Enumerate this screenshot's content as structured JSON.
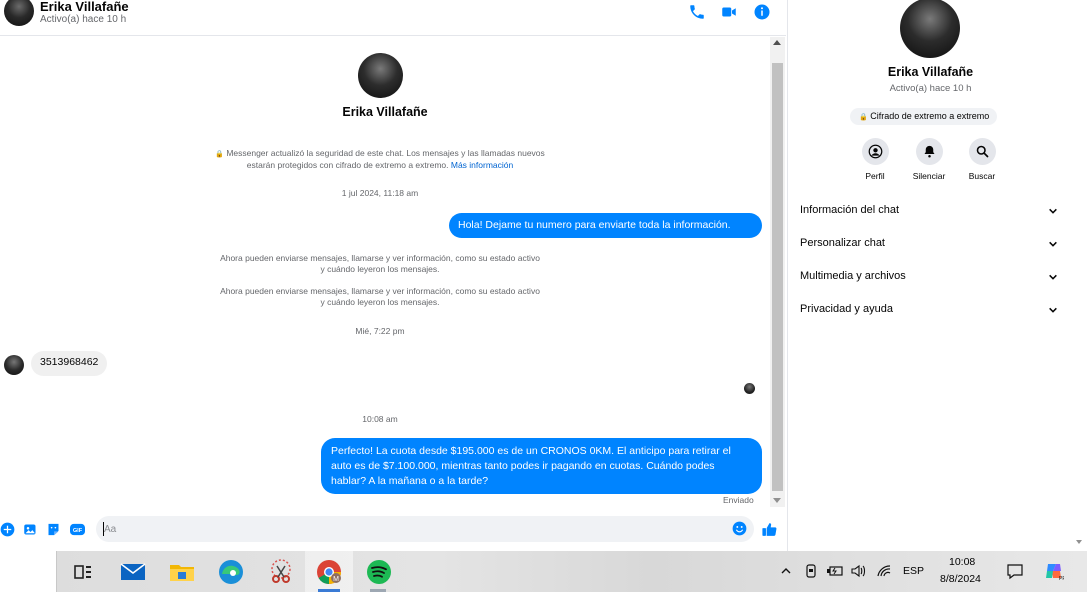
{
  "header": {
    "name": "Erika Villafañe",
    "status": "Activo(a) hace 10 h",
    "colors": {
      "accent": "#0084ff"
    },
    "icons": [
      "phone-icon",
      "video-icon",
      "info-icon"
    ]
  },
  "chat": {
    "contact_name": "Erika Villafañe",
    "security_notice": "Messenger actualizó la seguridad de este chat. Los mensajes y las llamadas nuevos estarán protegidos con cifrado de extremo a extremo.",
    "more_info_link": "Más información",
    "messages": [
      {
        "type": "timestamp",
        "text": "1 jul 2024, 11:18 am"
      },
      {
        "type": "outgoing",
        "text": "Hola! Dejame tu numero  para enviarte toda la información."
      },
      {
        "type": "system",
        "text": "Ahora pueden enviarse mensajes, llamarse y ver información, como su estado activo y cuándo leyeron los mensajes."
      },
      {
        "type": "system",
        "text": "Ahora pueden enviarse mensajes, llamarse y ver información, como su estado activo y cuándo leyeron los mensajes."
      },
      {
        "type": "timestamp",
        "text": "Mié, 7:22 pm"
      },
      {
        "type": "incoming",
        "text": "3513968462"
      },
      {
        "type": "timestamp",
        "text": "10:08 am"
      },
      {
        "type": "outgoing",
        "text": "Perfecto! La cuota desde $195.000 es de un CRONOS 0KM. El anticipo para retirar el auto es de $7.100.000, mientras tanto podes ir pagando en cuotas. Cuándo podes hablar? A la mañana o a la tarde?"
      }
    ],
    "delivery_status": "Enviado"
  },
  "composer": {
    "placeholder": "Aa",
    "icons": [
      "plus-icon",
      "image-icon",
      "sticker-icon",
      "gif-icon",
      "emoji-icon",
      "like-icon"
    ]
  },
  "panel": {
    "name": "Erika Villafañe",
    "status": "Activo(a) hace 10 h",
    "encryption_badge": "Cifrado de extremo a extremo",
    "actions": [
      {
        "label": "Perfil",
        "icon": "profile-icon"
      },
      {
        "label": "Silenciar",
        "icon": "bell-icon"
      },
      {
        "label": "Buscar",
        "icon": "search-icon"
      }
    ],
    "sections": [
      {
        "label": "Información del chat"
      },
      {
        "label": "Personalizar chat"
      },
      {
        "label": "Multimedia y archivos"
      },
      {
        "label": "Privacidad y ayuda"
      }
    ]
  },
  "taskbar": {
    "apps": [
      "task-view-icon",
      "mail-icon",
      "file-explorer-icon",
      "edge-icon",
      "snipping-tool-icon",
      "chrome-icon",
      "spotify-icon"
    ],
    "language": "ESP",
    "time": "10:08",
    "date": "8/8/2024"
  }
}
